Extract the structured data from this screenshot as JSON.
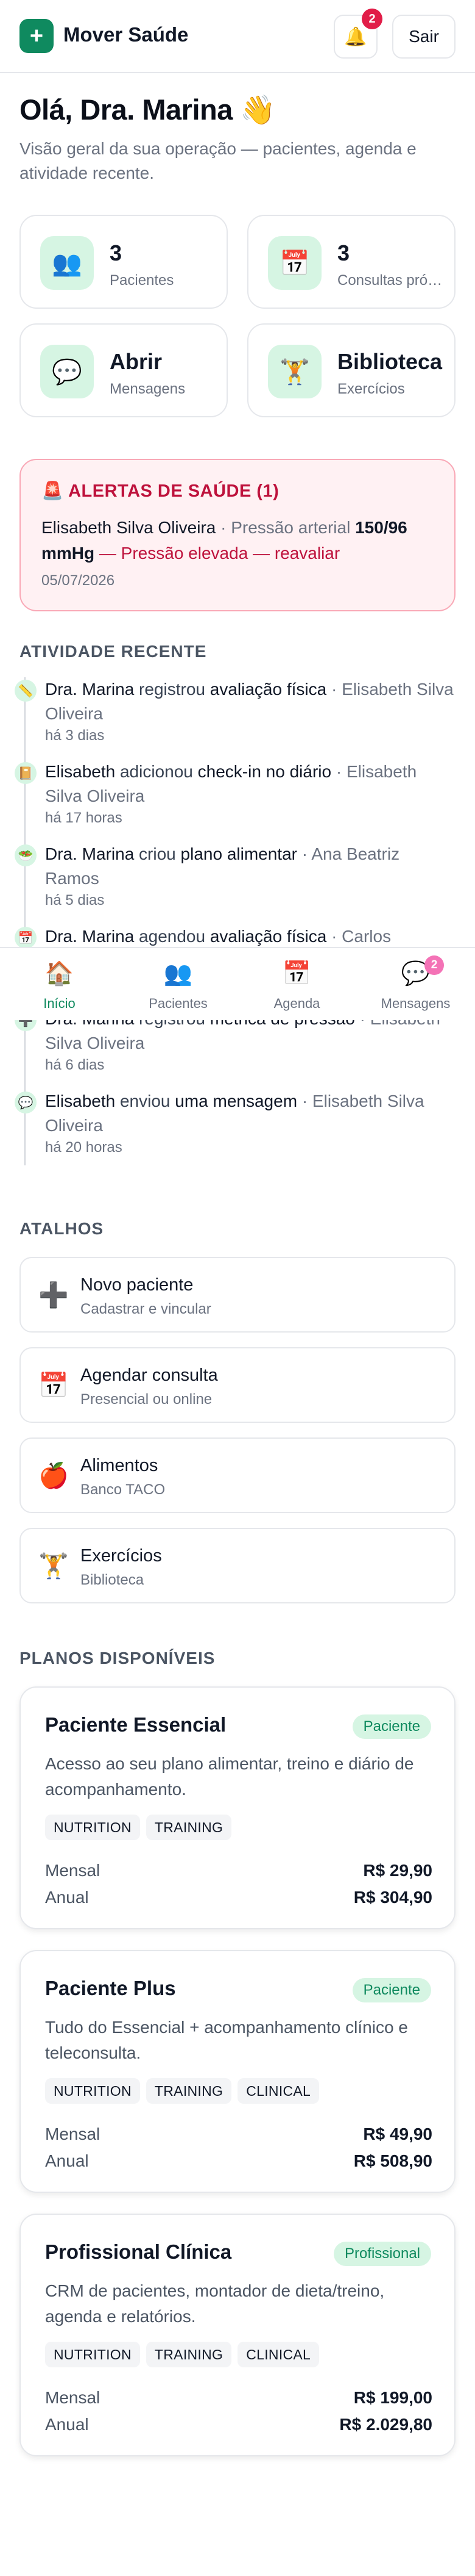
{
  "header": {
    "app_name": "Mover Saúde",
    "logo_glyph": "+",
    "notifications_count": "2",
    "logout_label": "Sair"
  },
  "greeting": {
    "title": "Olá, Dra. Marina 👋",
    "subtitle": "Visão geral da sua operação — pacientes, agenda e atividade recente."
  },
  "stats": [
    {
      "icon": "people-icon",
      "glyph": "👥",
      "value": "3",
      "label": "Pacientes"
    },
    {
      "icon": "calendar-icon",
      "glyph": "📅",
      "value": "3",
      "label": "Consultas próximas"
    },
    {
      "icon": "chat-icon",
      "glyph": "💬",
      "value": "Abrir",
      "label": "Mensagens"
    },
    {
      "icon": "dumbbell-icon",
      "glyph": "🏋️",
      "value": "Biblioteca",
      "label": "Exercícios"
    }
  ],
  "alerts": {
    "title": "🚨 ALERTAS DE SAÚDE (1)",
    "patient": "Elisabeth Silva Oliveira",
    "separator": "·",
    "metric_label": "Pressão arterial",
    "metric_value": "150/96 mmHg",
    "status": "— Pressão elevada — reavaliar",
    "date": "05/07/2026"
  },
  "activity": {
    "heading": "ATIVIDADE RECENTE",
    "items": [
      {
        "icon": "ruler-icon",
        "glyph": "📏",
        "actor": "Dra. Marina",
        "verb": "registrou",
        "object": "avaliação física",
        "sep": "·",
        "patient": "Elisabeth Silva Oliveira",
        "time": "há 3 dias"
      },
      {
        "icon": "journal-icon",
        "glyph": "📔",
        "actor": "Elisabeth",
        "verb": "adicionou",
        "object": "check-in no diário",
        "sep": "·",
        "patient": "Elisabeth Silva Oliveira",
        "time": "há 17 horas"
      },
      {
        "icon": "salad-icon",
        "glyph": "🥗",
        "actor": "Dra. Marina",
        "verb": "criou",
        "object": "plano alimentar",
        "sep": "·",
        "patient": "Ana Beatriz Ramos",
        "time": "há 5 dias"
      },
      {
        "icon": "calendar-icon",
        "glyph": "📅",
        "actor": "Dra. Marina",
        "verb": "agendou",
        "object": "avaliação física",
        "sep": "·",
        "patient": "Carlos",
        "time": ""
      },
      {
        "icon": "health-icon",
        "glyph": "➕",
        "actor": "Dra. Marina",
        "verb": "registrou",
        "object": "métrica de pressão",
        "sep": "·",
        "patient": "Elisabeth Silva Oliveira",
        "time": "há 6 dias"
      },
      {
        "icon": "message-icon",
        "glyph": "💬",
        "actor": "Elisabeth",
        "verb": "enviou",
        "object": "uma mensagem",
        "sep": "·",
        "patient": "Elisabeth Silva Oliveira",
        "time": "há 20 horas"
      }
    ]
  },
  "nav": {
    "items": [
      {
        "icon": "home-icon",
        "glyph": "🏠",
        "label": "Início",
        "active": true
      },
      {
        "icon": "people-icon",
        "glyph": "👥",
        "label": "Pacientes"
      },
      {
        "icon": "calendar-icon",
        "glyph": "📅",
        "label": "Agenda"
      },
      {
        "icon": "chat-icon",
        "glyph": "💬",
        "label": "Mensagens",
        "badge": "2"
      }
    ]
  },
  "shortcuts": {
    "heading": "ATALHOS",
    "items": [
      {
        "icon": "plus-icon",
        "glyph": "➕",
        "title": "Novo paciente",
        "subtitle": "Cadastrar e vincular"
      },
      {
        "icon": "calendar-icon",
        "glyph": "📅",
        "title": "Agendar consulta",
        "subtitle": "Presencial ou online"
      },
      {
        "icon": "apple-icon",
        "glyph": "🍎",
        "title": "Alimentos",
        "subtitle": "Banco TACO"
      },
      {
        "icon": "dumbbell-icon",
        "glyph": "🏋️",
        "title": "Exercícios",
        "subtitle": "Biblioteca"
      }
    ]
  },
  "plans": {
    "heading": "PLANOS DISPONÍVEIS",
    "monthly_label": "Mensal",
    "yearly_label": "Anual",
    "items": [
      {
        "name": "Paciente Essencial",
        "audience": "Paciente",
        "description": "Acesso ao seu plano alimentar, treino e diário de acompanhamento.",
        "tags": [
          "NUTRITION",
          "TRAINING"
        ],
        "monthly": "R$ 29,90",
        "yearly": "R$ 304,90"
      },
      {
        "name": "Paciente Plus",
        "audience": "Paciente",
        "description": "Tudo do Essencial + acompanhamento clínico e teleconsulta.",
        "tags": [
          "NUTRITION",
          "TRAINING",
          "CLINICAL"
        ],
        "monthly": "R$ 49,90",
        "yearly": "R$ 508,90"
      },
      {
        "name": "Profissional Clínica",
        "audience": "Profissional",
        "description": "CRM de pacientes, montador de dieta/treino, agenda e relatórios.",
        "tags": [
          "NUTRITION",
          "TRAINING",
          "CLINICAL"
        ],
        "monthly": "R$ 199,00",
        "yearly": "R$ 2.029,80"
      }
    ]
  }
}
